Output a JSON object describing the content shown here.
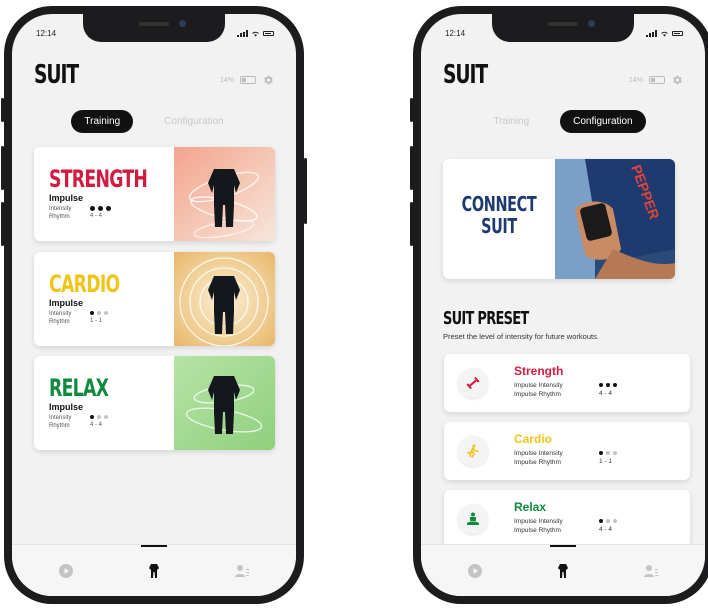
{
  "colors": {
    "strength": "#d11b3f",
    "cardio": "#f0c419",
    "relax": "#128a3e",
    "connect": "#1f3a6e"
  },
  "left_phone": {
    "status": {
      "time": "12:14"
    },
    "header": {
      "brand": "SUIT",
      "battery": "14%"
    },
    "tabs": [
      {
        "label": "Training",
        "active": true
      },
      {
        "label": "Configuration",
        "active": false
      }
    ],
    "cards": [
      {
        "title": "STRENGTH",
        "subtitle": "Impulse",
        "intensity_label": "Intensity",
        "rhythm_label": "Rhythm",
        "intensity_level": 3,
        "intensity_max": 3,
        "rhythm": "4 - 4",
        "icon": "suit-figure-icon"
      },
      {
        "title": "CARDIO",
        "subtitle": "Impulse",
        "intensity_label": "Intensity",
        "rhythm_label": "Rhythm",
        "intensity_level": 1,
        "intensity_max": 3,
        "rhythm": "1 - 1",
        "icon": "suit-figure-icon"
      },
      {
        "title": "RELAX",
        "subtitle": "Impulse",
        "intensity_label": "Intensity",
        "rhythm_label": "Rhythm",
        "intensity_level": 1,
        "intensity_max": 3,
        "rhythm": "4 - 4",
        "icon": "suit-figure-icon"
      }
    ],
    "nav": [
      "play-icon",
      "suit-icon",
      "profile-icon"
    ]
  },
  "right_phone": {
    "status": {
      "time": "12:14"
    },
    "header": {
      "brand": "SUIT",
      "battery": "14%"
    },
    "tabs": [
      {
        "label": "Training",
        "active": false
      },
      {
        "label": "Configuration",
        "active": true
      }
    ],
    "connect": {
      "line1": "CONNECT",
      "line2": "SUIT"
    },
    "preset": {
      "title": "SUIT PRESET",
      "description": "Preset the level of intensity for future workouts."
    },
    "presets": [
      {
        "name": "Strength",
        "intensity_label": "Impulse Intensity",
        "rhythm_label": "Impulse Rhythm",
        "intensity_level": 3,
        "intensity_max": 3,
        "rhythm": "4 - 4",
        "icon": "dumbbell-icon"
      },
      {
        "name": "Cardio",
        "intensity_label": "Impulse Intensity",
        "rhythm_label": "Impulse Rhythm",
        "intensity_level": 1,
        "intensity_max": 3,
        "rhythm": "1 - 1",
        "icon": "runner-icon"
      },
      {
        "name": "Relax",
        "intensity_label": "Impulse Intensity",
        "rhythm_label": "Impulse Rhythm",
        "intensity_level": 1,
        "intensity_max": 3,
        "rhythm": "4 - 4",
        "icon": "meditation-icon"
      }
    ],
    "nav": [
      "play-icon",
      "suit-icon",
      "profile-icon"
    ]
  }
}
